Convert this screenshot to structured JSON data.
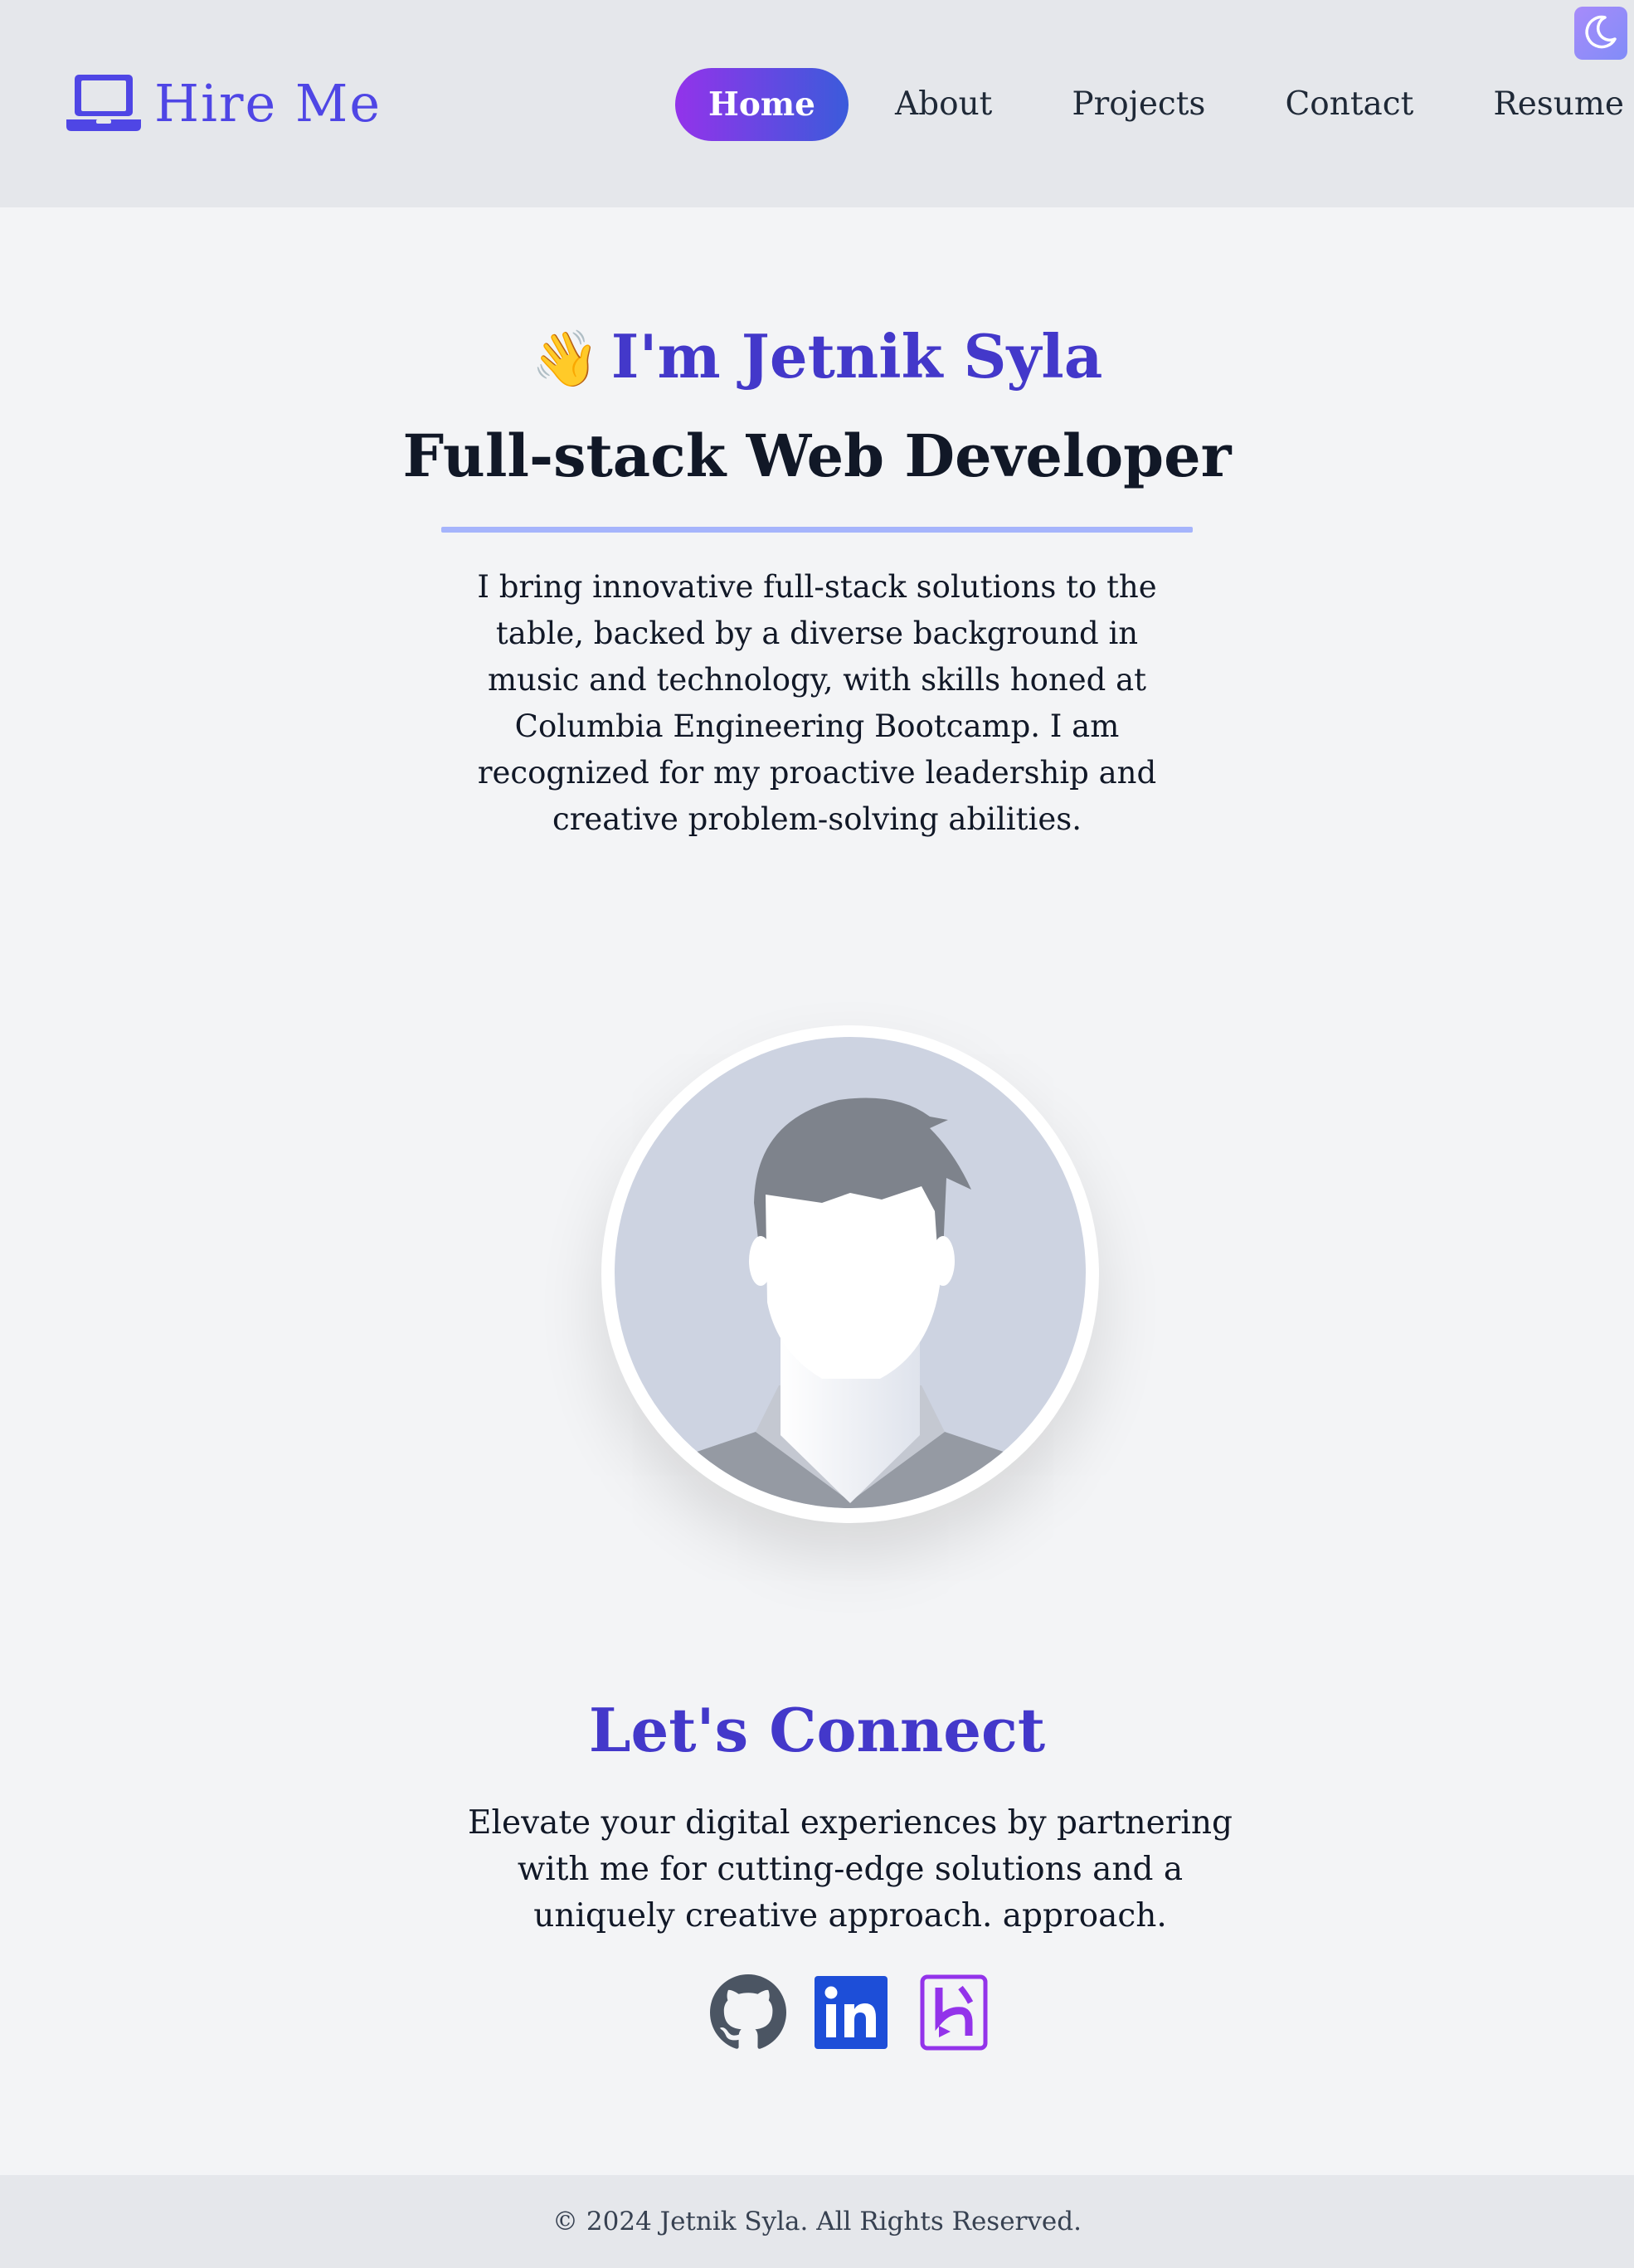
{
  "brand": {
    "name": "Hire Me",
    "icon": "laptop-icon"
  },
  "nav": {
    "items": [
      {
        "label": "Home",
        "active": true
      },
      {
        "label": "About",
        "active": false
      },
      {
        "label": "Projects",
        "active": false
      },
      {
        "label": "Contact",
        "active": false
      },
      {
        "label": "Resume",
        "active": false
      }
    ]
  },
  "theme_toggle": {
    "icon": "moon-icon"
  },
  "hero": {
    "wave": "👋",
    "greeting": "I'm Jetnik Syla",
    "role": "Full-stack Web Developer",
    "bio": "I bring innovative full-stack solutions to the table, backed by a diverse background in music and technology, with skills honed at Columbia Engineering Bootcamp. I am recognized for my proactive leadership and creative problem-solving abilities."
  },
  "avatar": {
    "icon": "default-avatar-icon"
  },
  "connect": {
    "title": "Let's Connect",
    "text": "Elevate your digital experiences by partnering with me for cutting-edge solutions and a uniquely creative approach. approach.",
    "socials": [
      {
        "icon": "github-icon"
      },
      {
        "icon": "linkedin-icon"
      },
      {
        "icon": "heroku-icon"
      }
    ]
  },
  "footer": {
    "text": "© 2024 Jetnik Syla. All Rights Reserved."
  },
  "colors": {
    "accent": "#4f46e5",
    "heading": "#4338ca",
    "nav_gradient_start": "#9333ea",
    "nav_gradient_end": "#3b5bdb",
    "page_bg": "#f3f4f6",
    "header_bg": "#e5e7eb"
  }
}
